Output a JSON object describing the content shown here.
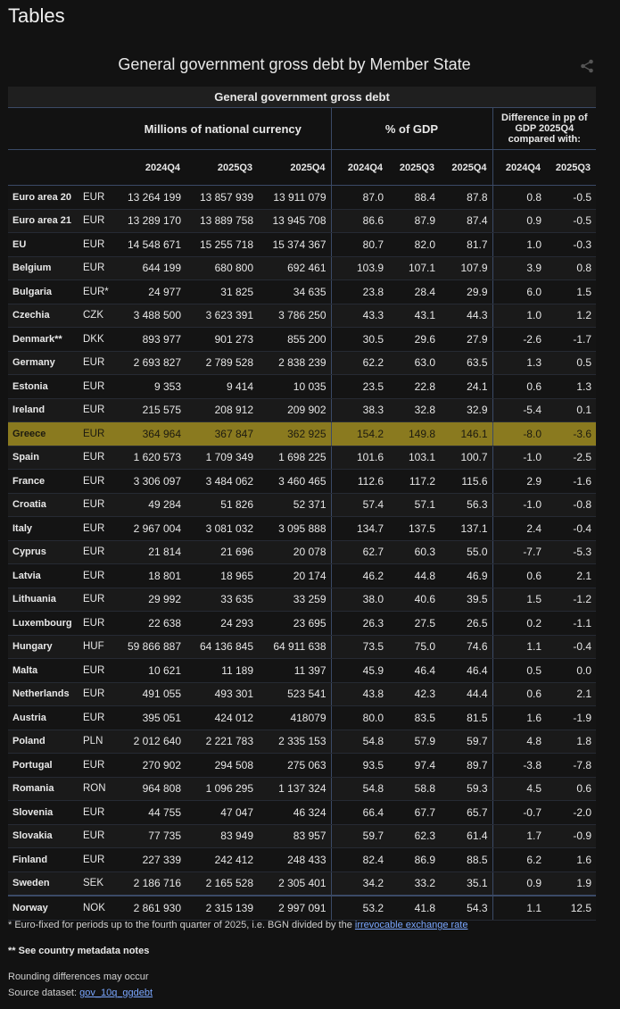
{
  "page": {
    "title": "Tables"
  },
  "table": {
    "title": "General government gross debt by Member State",
    "group_header": "General government gross debt",
    "col_groups": [
      "Millions of national currency",
      "% of GDP",
      "Difference in pp of GDP 2025Q4 compared with:"
    ],
    "periods": [
      "2024Q4",
      "2025Q3",
      "2025Q4",
      "2024Q4",
      "2025Q3",
      "2025Q4",
      "2024Q4",
      "2025Q3"
    ],
    "rows": [
      {
        "geo": "Euro area 20",
        "unit": "EUR",
        "v": [
          "13 264 199",
          "13 857 939",
          "13 911 079",
          "87.0",
          "88.4",
          "87.8",
          "0.8",
          "-0.5"
        ]
      },
      {
        "geo": "Euro area 21",
        "unit": "EUR",
        "v": [
          "13 289 170",
          "13 889 758",
          "13 945 708",
          "86.6",
          "87.9",
          "87.4",
          "0.9",
          "-0.5"
        ]
      },
      {
        "geo": "EU",
        "unit": "EUR",
        "v": [
          "14 548 671",
          "15 255 718",
          "15 374 367",
          "80.7",
          "82.0",
          "81.7",
          "1.0",
          "-0.3"
        ]
      },
      {
        "geo": "Belgium",
        "unit": "EUR",
        "v": [
          "644 199",
          "680 800",
          "692 461",
          "103.9",
          "107.1",
          "107.9",
          "3.9",
          "0.8"
        ]
      },
      {
        "geo": "Bulgaria",
        "unit": "EUR*",
        "v": [
          "24 977",
          "31 825",
          "34 635",
          "23.8",
          "28.4",
          "29.9",
          "6.0",
          "1.5"
        ]
      },
      {
        "geo": "Czechia",
        "unit": "CZK",
        "v": [
          "3 488 500",
          "3 623 391",
          "3 786 250",
          "43.3",
          "43.1",
          "44.3",
          "1.0",
          "1.2"
        ]
      },
      {
        "geo": "Denmark**",
        "unit": "DKK",
        "v": [
          "893 977",
          "901 273",
          "855 200",
          "30.5",
          "29.6",
          "27.9",
          "-2.6",
          "-1.7"
        ]
      },
      {
        "geo": "Germany",
        "unit": "EUR",
        "v": [
          "2 693 827",
          "2 789 528",
          "2 838 239",
          "62.2",
          "63.0",
          "63.5",
          "1.3",
          "0.5"
        ]
      },
      {
        "geo": "Estonia",
        "unit": "EUR",
        "v": [
          "9 353",
          "9 414",
          "10 035",
          "23.5",
          "22.8",
          "24.1",
          "0.6",
          "1.3"
        ]
      },
      {
        "geo": "Ireland",
        "unit": "EUR",
        "v": [
          "215 575",
          "208 912",
          "209 902",
          "38.3",
          "32.8",
          "32.9",
          "-5.4",
          "0.1"
        ]
      },
      {
        "geo": "Greece",
        "unit": "EUR",
        "v": [
          "364 964",
          "367 847",
          "362 925",
          "154.2",
          "149.8",
          "146.1",
          "-8.0",
          "-3.6"
        ],
        "highlight": true
      },
      {
        "geo": "Spain",
        "unit": "EUR",
        "v": [
          "1 620 573",
          "1 709 349",
          "1 698 225",
          "101.6",
          "103.1",
          "100.7",
          "-1.0",
          "-2.5"
        ]
      },
      {
        "geo": "France",
        "unit": "EUR",
        "v": [
          "3 306 097",
          "3 484 062",
          "3 460 465",
          "112.6",
          "117.2",
          "115.6",
          "2.9",
          "-1.6"
        ]
      },
      {
        "geo": "Croatia",
        "unit": "EUR",
        "v": [
          "49 284",
          "51 826",
          "52 371",
          "57.4",
          "57.1",
          "56.3",
          "-1.0",
          "-0.8"
        ]
      },
      {
        "geo": "Italy",
        "unit": "EUR",
        "v": [
          "2 967 004",
          "3 081 032",
          "3 095 888",
          "134.7",
          "137.5",
          "137.1",
          "2.4",
          "-0.4"
        ]
      },
      {
        "geo": "Cyprus",
        "unit": "EUR",
        "v": [
          "21 814",
          "21 696",
          "20 078",
          "62.7",
          "60.3",
          "55.0",
          "-7.7",
          "-5.3"
        ]
      },
      {
        "geo": "Latvia",
        "unit": "EUR",
        "v": [
          "18 801",
          "18 965",
          "20 174",
          "46.2",
          "44.8",
          "46.9",
          "0.6",
          "2.1"
        ]
      },
      {
        "geo": "Lithuania",
        "unit": "EUR",
        "v": [
          "29 992",
          "33 635",
          "33 259",
          "38.0",
          "40.6",
          "39.5",
          "1.5",
          "-1.2"
        ]
      },
      {
        "geo": "Luxembourg",
        "unit": "EUR",
        "v": [
          "22 638",
          "24 293",
          "23 695",
          "26.3",
          "27.5",
          "26.5",
          "0.2",
          "-1.1"
        ]
      },
      {
        "geo": "Hungary",
        "unit": "HUF",
        "v": [
          "59 866 887",
          "64 136 845",
          "64 911 638",
          "73.5",
          "75.0",
          "74.6",
          "1.1",
          "-0.4"
        ]
      },
      {
        "geo": "Malta",
        "unit": "EUR",
        "v": [
          "10 621",
          "11 189",
          "11 397",
          "45.9",
          "46.4",
          "46.4",
          "0.5",
          "0.0"
        ]
      },
      {
        "geo": "Netherlands",
        "unit": "EUR",
        "v": [
          "491 055",
          "493 301",
          "523 541",
          "43.8",
          "42.3",
          "44.4",
          "0.6",
          "2.1"
        ]
      },
      {
        "geo": "Austria",
        "unit": "EUR",
        "v": [
          "395 051",
          "424 012",
          "418079",
          "80.0",
          "83.5",
          "81.5",
          "1.6",
          "-1.9"
        ]
      },
      {
        "geo": "Poland",
        "unit": "PLN",
        "v": [
          "2 012 640",
          "2 221 783",
          "2 335 153",
          "54.8",
          "57.9",
          "59.7",
          "4.8",
          "1.8"
        ]
      },
      {
        "geo": "Portugal",
        "unit": "EUR",
        "v": [
          "270 902",
          "294 508",
          "275 063",
          "93.5",
          "97.4",
          "89.7",
          "-3.8",
          "-7.8"
        ]
      },
      {
        "geo": "Romania",
        "unit": "RON",
        "v": [
          "964 808",
          "1 096 295",
          "1 137 324",
          "54.8",
          "58.8",
          "59.3",
          "4.5",
          "0.6"
        ]
      },
      {
        "geo": "Slovenia",
        "unit": "EUR",
        "v": [
          "44 755",
          "47 047",
          "46 324",
          "66.4",
          "67.7",
          "65.7",
          "-0.7",
          "-2.0"
        ]
      },
      {
        "geo": "Slovakia",
        "unit": "EUR",
        "v": [
          "77 735",
          "83 949",
          "83 957",
          "59.7",
          "62.3",
          "61.4",
          "1.7",
          "-0.9"
        ]
      },
      {
        "geo": "Finland",
        "unit": "EUR",
        "v": [
          "227 339",
          "242 412",
          "248 433",
          "82.4",
          "86.9",
          "88.5",
          "6.2",
          "1.6"
        ]
      },
      {
        "geo": "Sweden",
        "unit": "SEK",
        "v": [
          "2 186 716",
          "2 165 528",
          "2 305 401",
          "34.2",
          "33.2",
          "35.1",
          "0.9",
          "1.9"
        ]
      },
      {
        "geo": "Norway",
        "unit": "NOK",
        "v": [
          "2 861 930",
          "2 315 139",
          "2 997 091",
          "53.2",
          "41.8",
          "54.3",
          "1.1",
          "12.5"
        ],
        "topline": true
      }
    ]
  },
  "footnotes": {
    "note1_text": "* Euro-fixed for periods up to the fourth quarter of 2025, i.e. BGN divided by the ",
    "note1_link": "irrevocable exchange rate",
    "note2": "** See country metadata notes",
    "rounding": "Rounding differences may occur",
    "source_label": "Source dataset: ",
    "source_link": "gov_10q_ggdebt"
  },
  "colors": {
    "highlight": "#8a7a1f",
    "link": "#7aa7ff",
    "background": "#121212"
  },
  "icons": {
    "share": "share-icon"
  }
}
